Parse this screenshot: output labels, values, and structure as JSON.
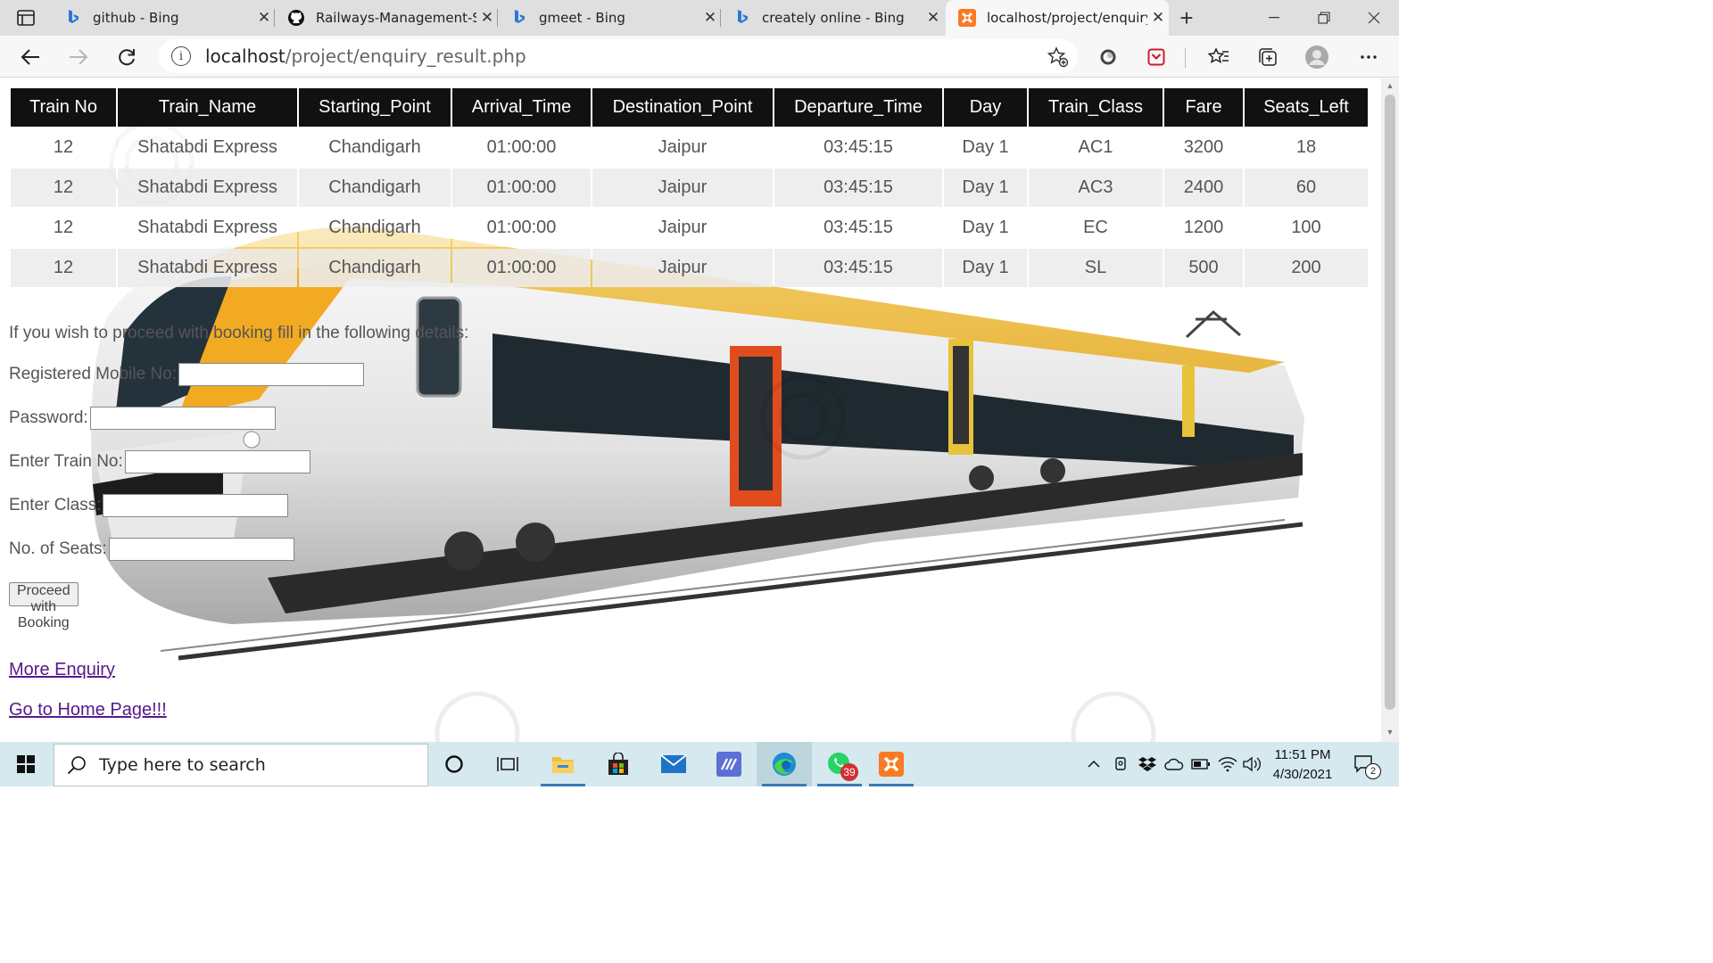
{
  "browser": {
    "tabs": [
      {
        "title": "github - Bing",
        "icon": "bing-icon"
      },
      {
        "title": "Railways-Management-Sy",
        "icon": "github-icon"
      },
      {
        "title": "gmeet - Bing",
        "icon": "bing-icon"
      },
      {
        "title": "creately online - Bing",
        "icon": "bing-icon"
      },
      {
        "title": "localhost/project/enquiry",
        "icon": "xampp-icon",
        "active": true
      }
    ],
    "address": {
      "host": "localhost",
      "path": "/project/enquiry_result.php"
    }
  },
  "results": {
    "headers": [
      "Train No",
      "Train_Name",
      "Starting_Point",
      "Arrival_Time",
      "Destination_Point",
      "Departure_Time",
      "Day",
      "Train_Class",
      "Fare",
      "Seats_Left"
    ],
    "rows": [
      [
        "12",
        "Shatabdi Express",
        "Chandigarh",
        "01:00:00",
        "Jaipur",
        "03:45:15",
        "Day 1",
        "AC1",
        "3200",
        "18"
      ],
      [
        "12",
        "Shatabdi Express",
        "Chandigarh",
        "01:00:00",
        "Jaipur",
        "03:45:15",
        "Day 1",
        "AC3",
        "2400",
        "60"
      ],
      [
        "12",
        "Shatabdi Express",
        "Chandigarh",
        "01:00:00",
        "Jaipur",
        "03:45:15",
        "Day 1",
        "EC",
        "1200",
        "100"
      ],
      [
        "12",
        "Shatabdi Express",
        "Chandigarh",
        "01:00:00",
        "Jaipur",
        "03:45:15",
        "Day 1",
        "SL",
        "500",
        "200"
      ]
    ]
  },
  "booking": {
    "intro": "If you wish to proceed with booking fill in the following details:",
    "fields": [
      {
        "label": "Registered Mobile No:",
        "value": ""
      },
      {
        "label": "Password:",
        "value": ""
      },
      {
        "label": "Enter Train No:",
        "value": ""
      },
      {
        "label": "Enter Class:",
        "value": ""
      },
      {
        "label": "No. of Seats:",
        "value": ""
      }
    ],
    "submit_label": "Proceed with Booking"
  },
  "links": {
    "more_enquiry": "More Enquiry",
    "home": "Go to Home Page!!!"
  },
  "taskbar": {
    "search_placeholder": "Type here to search",
    "whatsapp_badge": "39",
    "notification_count": "2",
    "time": "11:51 PM",
    "date": "4/30/2021"
  },
  "colors": {
    "header_bg": "#111111",
    "link_visited": "#551a8b",
    "taskbar_bg": "#d5e9ef",
    "tabstrip_bg": "#dfdfdf"
  }
}
